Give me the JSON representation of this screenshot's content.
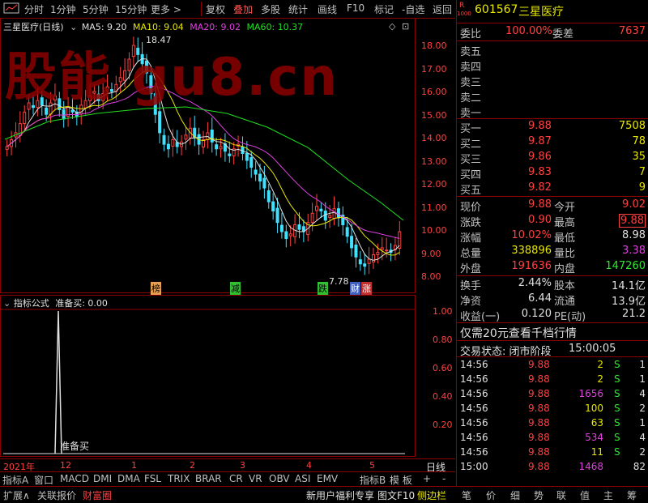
{
  "toolbar": {
    "left_items": [
      "分时",
      "1分钟",
      "5分钟",
      "15分钟",
      "更多 >"
    ],
    "right_items": [
      "复权",
      "叠加",
      "多股",
      "统计",
      "画线",
      "F10",
      "标记",
      "-自选",
      "返回"
    ]
  },
  "chart_header": {
    "stock_name": "三星医疗(日线)",
    "ma5": "MA5: 9.20",
    "ma10": "MA10: 9.04",
    "ma20": "MA20: 9.02",
    "ma60": "MA60: 10.37",
    "colors": {
      "ma5": "#e0e0e0",
      "ma10": "#e8e800",
      "ma20": "#e040e0",
      "ma60": "#20e020"
    }
  },
  "watermark": "股能 gu8.cn",
  "main_axis": [
    "18.00",
    "17.00",
    "16.00",
    "15.00",
    "14.00",
    "13.00",
    "12.00",
    "11.00",
    "10.00",
    "9.00",
    "8.00"
  ],
  "annotations": {
    "high": "18.47",
    "low": "7.78"
  },
  "markers": [
    "榜",
    "减",
    "跌",
    "财",
    "涨"
  ],
  "sub_header": {
    "title": "指标公式",
    "value": "准备买: 0.00"
  },
  "sub_axis": [
    "1.00",
    "0.80",
    "0.60",
    "0.40",
    "0.20"
  ],
  "sub_label": "准备买",
  "dates": {
    "year": "2021年",
    "months": [
      "12",
      "1",
      "2",
      "3",
      "4",
      "5"
    ],
    "period": "日线"
  },
  "indicator_tabs": [
    "指标A",
    "窗口",
    "MACD",
    "DMI",
    "DMA",
    "FSL",
    "TRIX",
    "BRAR",
    "CR",
    "VR",
    "OBV",
    "ASI",
    "EMV"
  ],
  "indicator_tabs_right": [
    "指标B",
    "模 板",
    "+",
    "-"
  ],
  "bottom_left": [
    "扩展∧",
    "关联报价",
    "财富圈"
  ],
  "bottom_mid": [
    "新用户福利专享",
    "图文F10",
    "侧边栏"
  ],
  "bottom_right": [
    "笔",
    "价",
    "细",
    "势",
    "联",
    "值",
    "主",
    "筹"
  ],
  "quote": {
    "code": "601567",
    "name": "三星医疗",
    "r_badge": "R",
    "lvl_badge": "1000",
    "weibi_label": "委比",
    "weibi": "100.00%",
    "weicha_label": "委差",
    "weicha": "7637",
    "asks": [
      {
        "label": "卖五",
        "price": "",
        "vol": ""
      },
      {
        "label": "卖四",
        "price": "",
        "vol": ""
      },
      {
        "label": "卖三",
        "price": "",
        "vol": ""
      },
      {
        "label": "卖二",
        "price": "",
        "vol": ""
      },
      {
        "label": "卖一",
        "price": "",
        "vol": ""
      }
    ],
    "bids": [
      {
        "label": "买一",
        "price": "9.88",
        "vol": "7508"
      },
      {
        "label": "买二",
        "price": "9.87",
        "vol": "78"
      },
      {
        "label": "买三",
        "price": "9.86",
        "vol": "35"
      },
      {
        "label": "买四",
        "price": "9.83",
        "vol": "7"
      },
      {
        "label": "买五",
        "price": "9.82",
        "vol": "9"
      }
    ],
    "stats": [
      {
        "l1": "现价",
        "v1": "9.88",
        "c1": "red",
        "l2": "今开",
        "v2": "9.02",
        "c2": "red"
      },
      {
        "l1": "涨跌",
        "v1": "0.90",
        "c1": "red",
        "l2": "最高",
        "v2": "9.88",
        "c2": "red"
      },
      {
        "l1": "涨幅",
        "v1": "10.02%",
        "c1": "red",
        "l2": "最低",
        "v2": "8.98",
        "c2": "white"
      },
      {
        "l1": "总量",
        "v1": "338896",
        "c1": "yellow",
        "l2": "量比",
        "v2": "3.38",
        "c2": "magenta"
      },
      {
        "l1": "外盘",
        "v1": "191636",
        "c1": "red",
        "l2": "内盘",
        "v2": "147260",
        "c2": "green"
      }
    ],
    "stats2": [
      {
        "l1": "换手",
        "v1": "2.44%",
        "l2": "股本",
        "v2": "14.1亿"
      },
      {
        "l1": "净资",
        "v1": "6.44",
        "l2": "流通",
        "v2": "13.9亿"
      },
      {
        "l1": "收益(一)",
        "v1": "0.120",
        "l2": "PE(动)",
        "v2": "21.2"
      }
    ],
    "promo": "仅需20元查看千档行情",
    "status_label": "交易状态: 闭市阶段",
    "status_time": "15:00:05",
    "ticks": [
      {
        "time": "14:56",
        "price": "9.88",
        "vol": "2",
        "side": "S",
        "n": "1",
        "vc": "yellow"
      },
      {
        "time": "14:56",
        "price": "9.88",
        "vol": "2",
        "side": "S",
        "n": "1",
        "vc": "yellow"
      },
      {
        "time": "14:56",
        "price": "9.88",
        "vol": "1656",
        "side": "S",
        "n": "4",
        "vc": "magenta"
      },
      {
        "time": "14:56",
        "price": "9.88",
        "vol": "100",
        "side": "S",
        "n": "2",
        "vc": "yellow"
      },
      {
        "time": "14:56",
        "price": "9.88",
        "vol": "63",
        "side": "S",
        "n": "1",
        "vc": "yellow"
      },
      {
        "time": "14:56",
        "price": "9.88",
        "vol": "534",
        "side": "S",
        "n": "4",
        "vc": "magenta"
      },
      {
        "time": "14:56",
        "price": "9.88",
        "vol": "11",
        "side": "S",
        "n": "2",
        "vc": "yellow"
      },
      {
        "time": "15:00",
        "price": "9.88",
        "vol": "1468",
        "side": "",
        "n": "82",
        "vc": "magenta"
      }
    ]
  }
}
